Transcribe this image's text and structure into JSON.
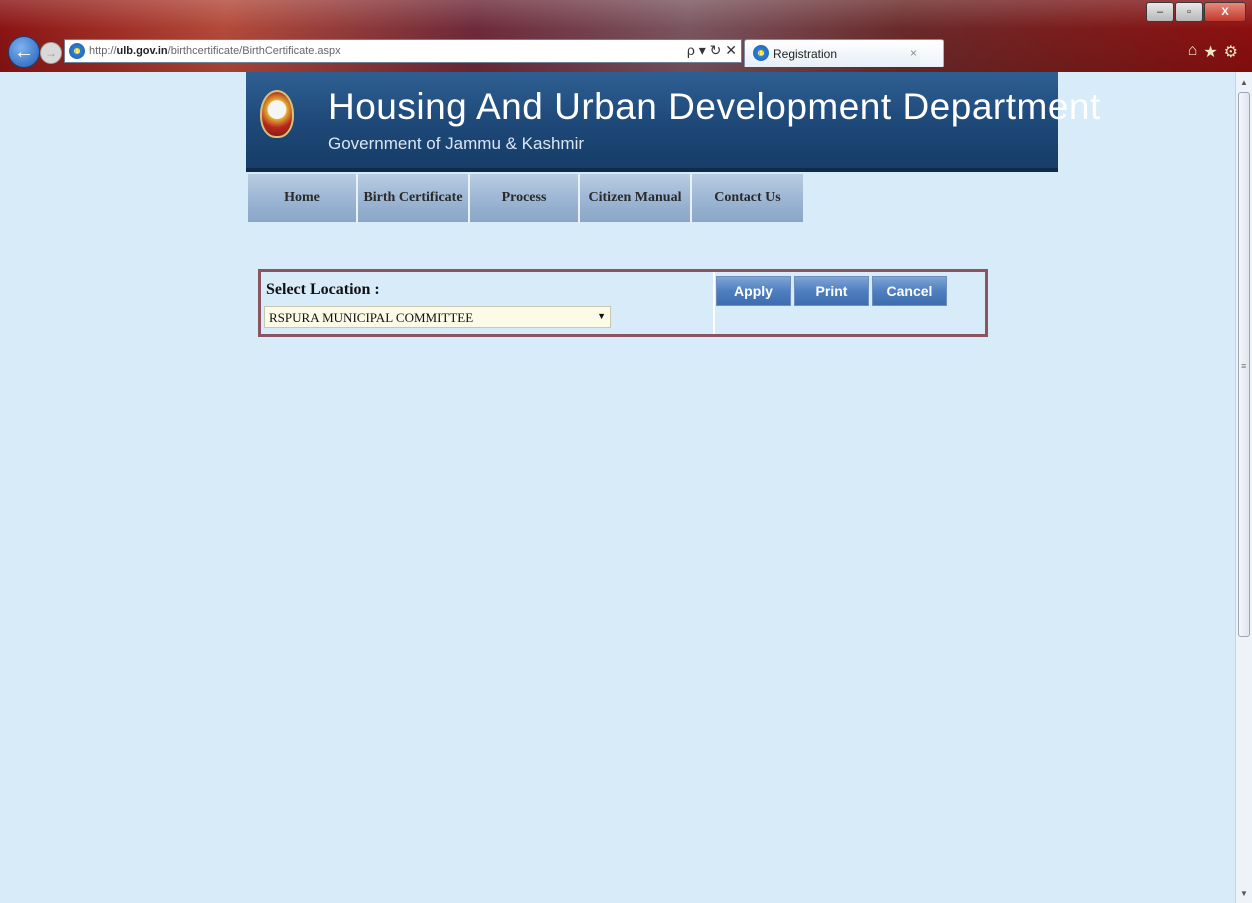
{
  "browser": {
    "url_prefix": "http://",
    "url_host": "ulb.gov.in",
    "url_path": "/birthcertificate/BirthCertificate.aspx",
    "tab_title": "Registration",
    "tab_close": "×",
    "win_minimize": "–",
    "win_maximize": "▫",
    "win_close": "X",
    "back": "←",
    "forward": "→",
    "addr_tools": "ρ ▾ ↻ ✕",
    "home": "⌂",
    "favorites": "★",
    "settings": "⚙"
  },
  "header": {
    "title": "Housing And Urban Development Department",
    "subtitle": "Government of Jammu & Kashmir"
  },
  "menu": {
    "items": [
      {
        "label": "Home"
      },
      {
        "label": "Birth Certificate"
      },
      {
        "label": "Process"
      },
      {
        "label": "Citizen Manual"
      },
      {
        "label": "Contact Us"
      }
    ]
  },
  "form": {
    "location_label": "Select Location :",
    "location_value": "RSPURA MUNICIPAL COMMITTEE",
    "apply_label": "Apply",
    "print_label": "Print",
    "cancel_label": "Cancel"
  },
  "icons": {
    "ie": "e",
    "dropdown": "▼",
    "scroll_up": "▲",
    "scroll_down": "▼",
    "grip": "≡"
  }
}
